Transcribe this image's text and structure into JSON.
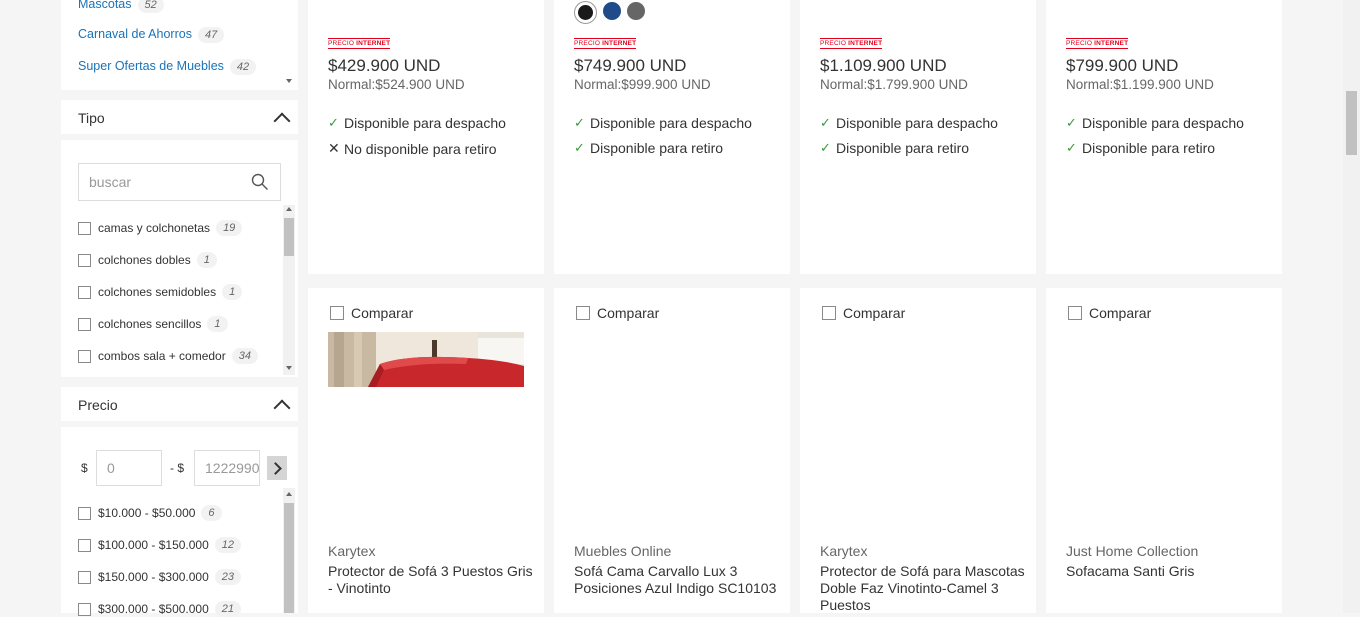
{
  "categories": [
    {
      "label": "Mascotas",
      "count": "52"
    },
    {
      "label": "Carnaval de Ahorros",
      "count": "47"
    },
    {
      "label": "Super Ofertas de Muebles",
      "count": "42"
    }
  ],
  "tipo": {
    "title": "Tipo",
    "search_placeholder": "buscar",
    "items": [
      {
        "label": "camas y colchonetas",
        "count": "19"
      },
      {
        "label": "colchones dobles",
        "count": "1"
      },
      {
        "label": "colchones semidobles",
        "count": "1"
      },
      {
        "label": "colchones sencillos",
        "count": "1"
      },
      {
        "label": "combos sala + comedor",
        "count": "34"
      }
    ]
  },
  "precio": {
    "title": "Precio",
    "currency": "$",
    "separator": "- $",
    "min_placeholder": "0",
    "max_placeholder": "1222990",
    "items": [
      {
        "label": "$10.000 - $50.000",
        "count": "6"
      },
      {
        "label": "$100.000 - $150.000",
        "count": "12"
      },
      {
        "label": "$150.000 - $300.000",
        "count": "23"
      },
      {
        "label": "$300.000 - $500.000",
        "count": "21"
      }
    ]
  },
  "badge": {
    "prefix": "PRECIO",
    "strong": "INTERNET"
  },
  "compare_label": "Comparar",
  "top_products": [
    {
      "price": "$429.900 UND",
      "normal": "Normal:$524.900 UND",
      "dispatch": "Disponible para despacho",
      "dispatch_ok": true,
      "pickup": "No disponible para retiro",
      "pickup_ok": false,
      "swatches": []
    },
    {
      "price": "$749.900 UND",
      "normal": "Normal:$999.900 UND",
      "dispatch": "Disponible para despacho",
      "dispatch_ok": true,
      "pickup": "Disponible para retiro",
      "pickup_ok": true,
      "swatches": [
        "#1a1a1a",
        "#1f4b8a",
        "#666666"
      ]
    },
    {
      "price": "$1.109.900 UND",
      "normal": "Normal:$1.799.900 UND",
      "dispatch": "Disponible para despacho",
      "dispatch_ok": true,
      "pickup": "Disponible para retiro",
      "pickup_ok": true,
      "swatches": []
    },
    {
      "price": "$799.900 UND",
      "normal": "Normal:$1.199.900 UND",
      "dispatch": "Disponible para despacho",
      "dispatch_ok": true,
      "pickup": "Disponible para retiro",
      "pickup_ok": true,
      "swatches": []
    }
  ],
  "bottom_products": [
    {
      "brand": "Karytex",
      "name": "Protector de Sofá 3 Puestos Gris - Vinotinto",
      "has_image": true
    },
    {
      "brand": "Muebles Online",
      "name": "Sofá Cama Carvallo Lux 3 Posiciones Azul Indigo SC10103",
      "has_image": false
    },
    {
      "brand": "Karytex",
      "name": "Protector de Sofá para Mascotas Doble Faz Vinotinto-Camel 3 Puestos",
      "has_image": false
    },
    {
      "brand": "Just Home Collection",
      "name": "Sofacama Santi Gris",
      "has_image": false
    }
  ],
  "colors": {
    "accent_red": "#e0001b",
    "link_blue": "#1a73b8",
    "check_green": "#3a9a3a"
  }
}
